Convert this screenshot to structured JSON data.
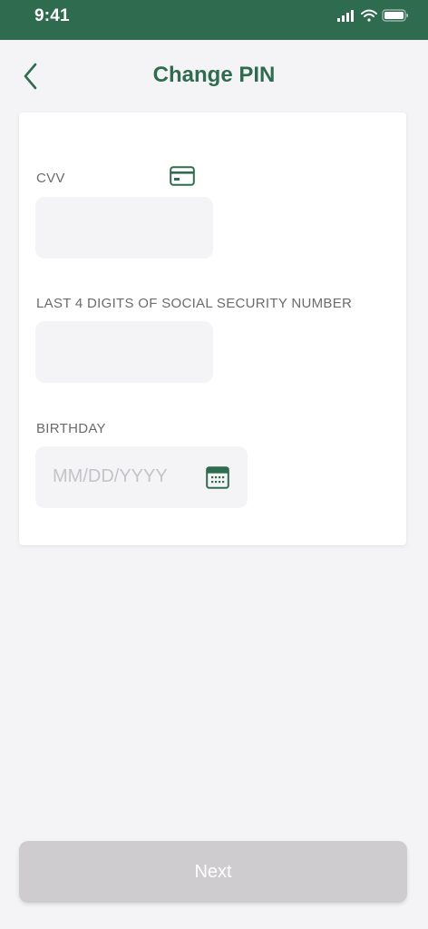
{
  "status_bar": {
    "time": "9:41",
    "background_color": "#2e6b4f",
    "icons": [
      "cellular-signal-icon",
      "wifi-icon",
      "battery-icon"
    ]
  },
  "header": {
    "title": "Change PIN",
    "back_icon": "chevron-left-icon",
    "accent_color": "#2e6b4f"
  },
  "form": {
    "cvv": {
      "label": "CVV",
      "value": "",
      "icon": "credit-card-icon"
    },
    "ssn": {
      "label": "LAST 4 DIGITS OF SOCIAL SECURITY NUMBER",
      "value": ""
    },
    "birthday": {
      "label": "BIRTHDAY",
      "placeholder": "MM/DD/YYYY",
      "icon": "calendar-icon"
    }
  },
  "footer": {
    "next_label": "Next",
    "next_disabled": true,
    "next_color": "#cecccf"
  }
}
